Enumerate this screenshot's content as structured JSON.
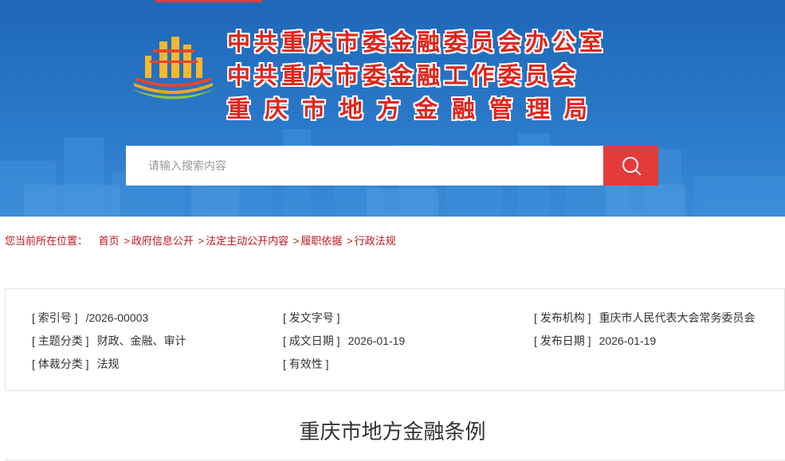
{
  "header": {
    "title_lines": [
      "中共重庆市委金融委员会办公室",
      "中共重庆市委金融工作委员会",
      "重庆市地方金融管理局"
    ],
    "search": {
      "placeholder": "请输入搜索内容"
    },
    "icons": {
      "logo": "emblem-logo-icon",
      "search": "search-icon"
    },
    "colors": {
      "banner": "#2a78c9",
      "accent": "#e43a3a",
      "title_red": "#e0251b"
    }
  },
  "breadcrumb": {
    "lead": "您当前所在位置：",
    "items": [
      "首页",
      "政府信息公开",
      "法定主动公开内容",
      "履职依据",
      "行政法规"
    ],
    "separator": ">"
  },
  "meta": {
    "index_no": {
      "label": "[ 索引号 ]",
      "value": "/2026-00003"
    },
    "doc_no": {
      "label": "[ 发文字号 ]",
      "value": ""
    },
    "issuer": {
      "label": "[ 发布机构 ]",
      "value": "重庆市人民代表大会常务委员会"
    },
    "topic": {
      "label": "[ 主题分类 ]",
      "value": "财政、金融、审计"
    },
    "created": {
      "label": "[ 成文日期 ]",
      "value": "2026-01-19"
    },
    "published": {
      "label": "[ 发布日期 ]",
      "value": "2026-01-19"
    },
    "genre": {
      "label": "[ 体裁分类 ]",
      "value": "法规"
    },
    "validity": {
      "label": "[ 有效性 ]",
      "value": ""
    }
  },
  "document": {
    "title": "重庆市地方金融条例"
  }
}
